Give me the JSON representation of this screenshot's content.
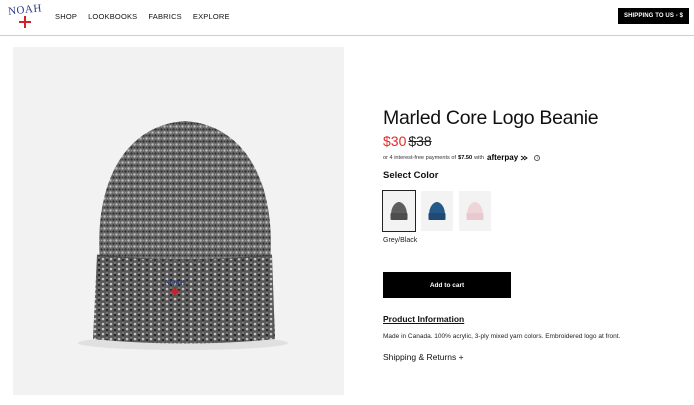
{
  "header": {
    "logo_text": "NOAH",
    "nav_items": [
      "SHOP",
      "LOOKBOOKS",
      "FABRICS",
      "EXPLORE"
    ],
    "shipping_button": "SHIPPING TO US - $"
  },
  "product": {
    "title": "Marled Core Logo Beanie",
    "sale_price": "$30",
    "original_price": "$38",
    "afterpay": {
      "prefix": "or 4 interest-free payments of",
      "amount": "$7.50",
      "suffix": "with",
      "brand": "afterpay",
      "info_icon": "i"
    },
    "select_color_label": "Select Color",
    "swatches": [
      {
        "name": "Grey/Black",
        "color": "#5e5e5e",
        "selected": true
      },
      {
        "name": "Navy",
        "color": "#1f4a73",
        "selected": false
      },
      {
        "name": "Pink",
        "color": "#e8c9cf",
        "selected": false
      }
    ],
    "selected_color_name": "Grey/Black",
    "add_to_cart": "Add to cart",
    "product_info_heading": "Product Information",
    "product_info_text": "Made in Canada. 100% acrylic, 3-ply mixed yarn colors. Embroidered logo at front.",
    "shipping_returns": "Shipping & Returns +"
  },
  "colors": {
    "sale_red": "#e02b27",
    "logo_blue": "#2a3a8c",
    "logo_red": "#d4202a"
  }
}
